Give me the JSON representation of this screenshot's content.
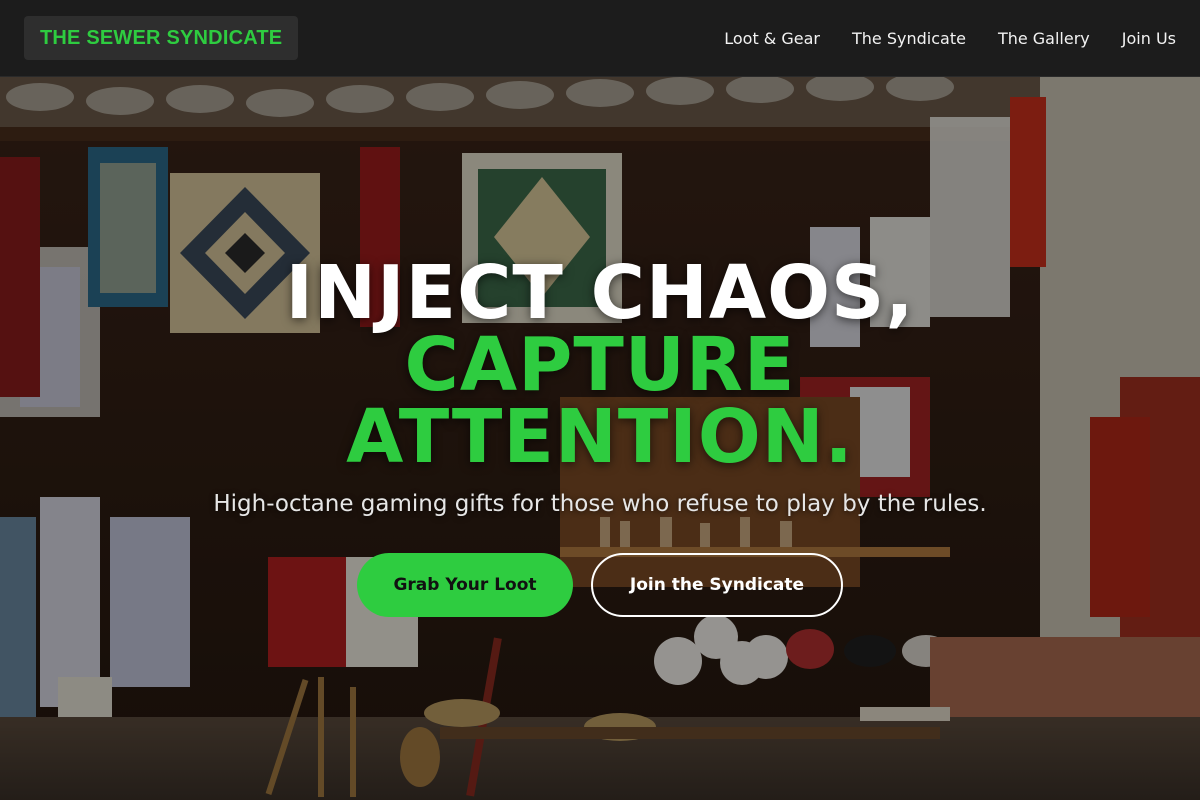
{
  "nav": {
    "brand": "THE SEWER SYNDICATE",
    "links": [
      "Loot & Gear",
      "The Syndicate",
      "The Gallery",
      "Join Us"
    ]
  },
  "hero": {
    "headline_line1": "INJECT CHAOS,",
    "headline_line2": "CAPTURE ATTENTION.",
    "subtitle": "High-octane gaming gifts for those who refuse to play by the rules.",
    "primary_cta": "Grab Your Loot",
    "secondary_cta": "Join the Syndicate"
  },
  "colors": {
    "accent": "#2ecc40",
    "navbar": "#1c1c1c",
    "brand_bg": "#2e2e2e"
  }
}
